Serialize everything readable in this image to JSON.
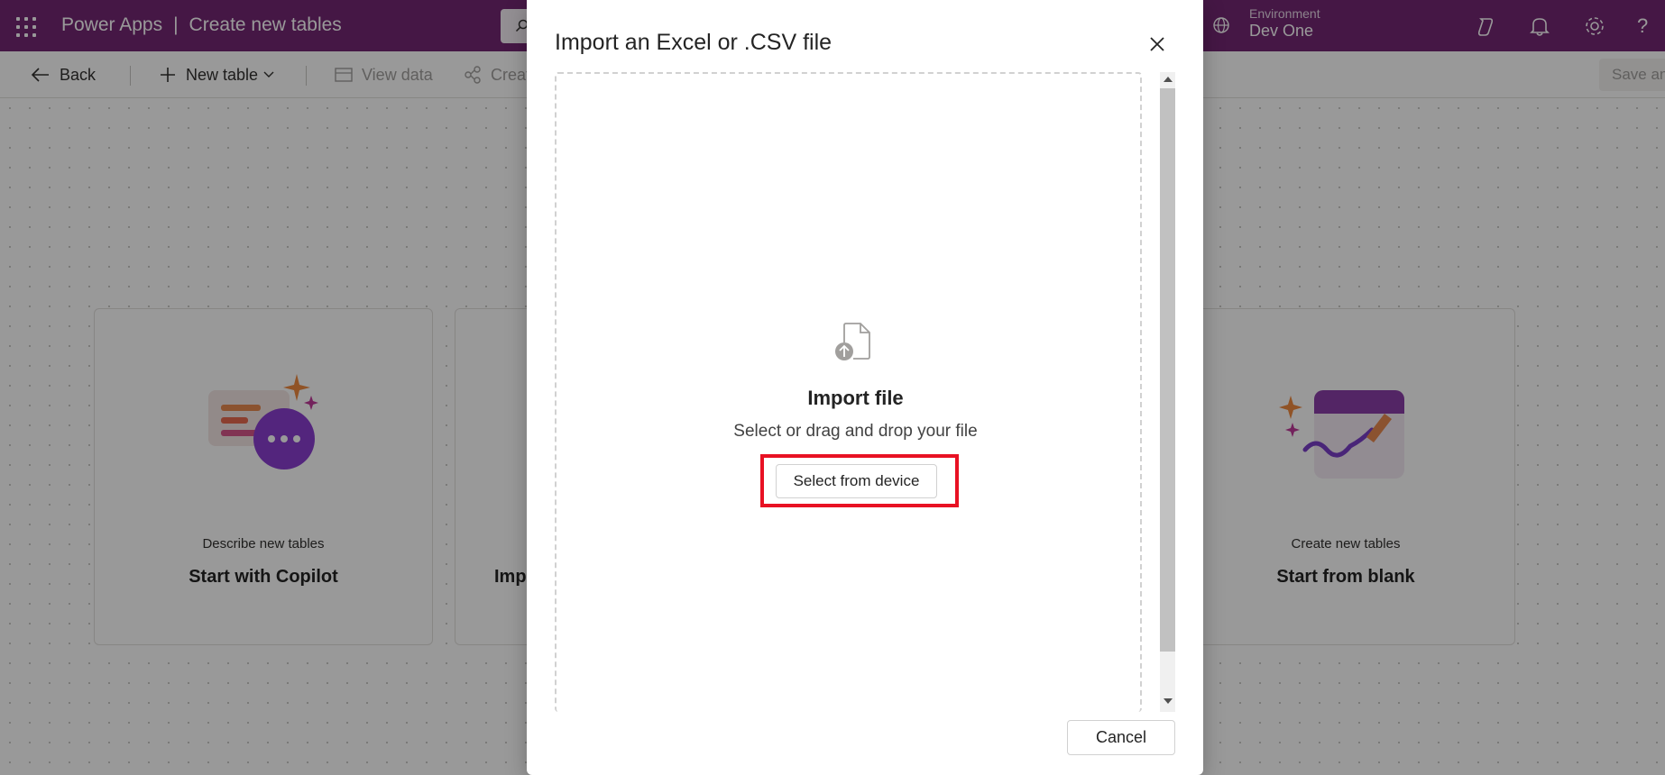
{
  "header": {
    "app_name": "Power Apps",
    "separator": "|",
    "page_title": "Create new tables",
    "environment_label": "Environment",
    "environment_name": "Dev One",
    "icons": [
      "waffle-icon",
      "search-icon",
      "environment-icon",
      "copilot-icon",
      "bell-icon",
      "gear-icon",
      "help-icon"
    ],
    "help_glyph": "?"
  },
  "commandbar": {
    "back": "Back",
    "new_table": "New table",
    "view_data": "View data",
    "create": "Creat",
    "save": "Save an"
  },
  "cards": [
    {
      "subtitle": "Describe new tables",
      "title": "Start with Copilot"
    },
    {
      "subtitle": "",
      "title": "Imp"
    },
    {
      "subtitle": "Create new tables",
      "title": "Start from blank"
    }
  ],
  "dialog": {
    "title": "Import an Excel or .CSV file",
    "import_heading": "Import file",
    "import_subtext": "Select or drag and drop your file",
    "select_button": "Select from device",
    "cancel_button": "Cancel"
  },
  "colors": {
    "brand": "#742774",
    "highlight": "#e81123"
  }
}
